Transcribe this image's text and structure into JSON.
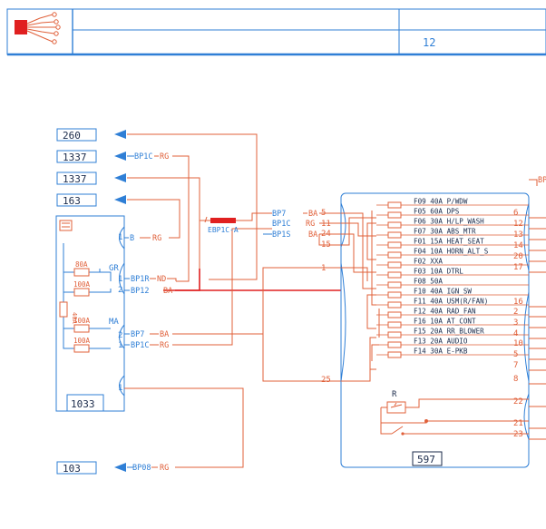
{
  "header": {
    "page_number": "12"
  },
  "colors": {
    "wire": "#e0603a",
    "frame": "#2f7fd6",
    "connector": "#e02020",
    "label": "#1a2a4a"
  },
  "references": [
    "260",
    "1337",
    "1337",
    "163",
    "103"
  ],
  "left_box": {
    "id": "1033",
    "ground_label": "GR",
    "ma_label": "MA",
    "fuse_80a": "80A",
    "fuse_100a": "100A",
    "fuse_40a": "40A"
  },
  "wires": {
    "w1": "BP1C",
    "w1c": "RG",
    "w2": "B",
    "w2c": "RG",
    "w3": "BP1R",
    "w3c": "ND",
    "w4": "BP12",
    "w4c": "BA",
    "w5": "BP7",
    "w5c": "BA",
    "w6": "BP1C",
    "w6c": "RG",
    "w7": "BP7",
    "w7c": "BA",
    "w8": "BP1C",
    "w8c": "RG",
    "w9": "BP1S",
    "w9c": "BA",
    "w10": "BP08",
    "w10c": "RG",
    "right_label": "BP"
  },
  "left_pins": [
    "1",
    "1",
    "2",
    "2",
    "1",
    "1"
  ],
  "connector_label": "EBP1C-A",
  "fusebox": {
    "id": "597",
    "relay_label": "R",
    "left_pins": [
      "5",
      "11",
      "24",
      "15",
      "1",
      "25"
    ],
    "right_pins": [
      "6",
      "12",
      "13",
      "14",
      "20",
      "17",
      "16",
      "2",
      "3",
      "4",
      "10",
      "5",
      "7",
      "8",
      "22",
      "21",
      "23"
    ],
    "fuses": [
      "F09 40A P/WDW",
      "F05 60A DPS",
      "F06 30A H/LP_WASH",
      "F07 30A ABS_MTR",
      "F01 15A HEAT_SEAT",
      "F04 10A HORN_ALT_S",
      "F02 XXA",
      "F03 10A DTRL",
      "F08 50A",
      "F10 40A IGN_SW",
      "F11 40A USM(R/FAN)",
      "F12 40A RAD_FAN",
      "F16 10A AT_CONT",
      "F15 20A RR_BLOWER",
      "F13 20A AUDIO",
      "F14 30A E-PKB"
    ]
  }
}
